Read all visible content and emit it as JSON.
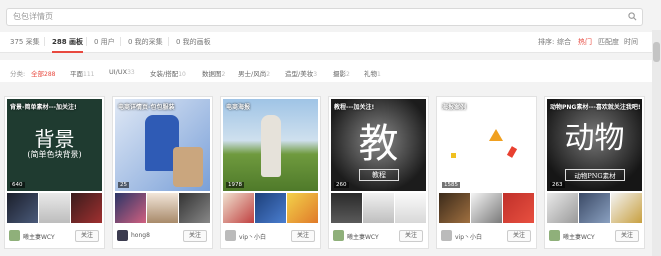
{
  "search": {
    "placeholder": "包包详情页"
  },
  "tabs": [
    {
      "label": "375 采集"
    },
    {
      "label": "288 画板"
    },
    {
      "label": "0 用户"
    },
    {
      "label": "0 我的采集"
    },
    {
      "label": "0 我的画板"
    }
  ],
  "sort": {
    "label": "排序:",
    "options": [
      "综合",
      "热门",
      "匹配度",
      "时间"
    ],
    "active": "热门"
  },
  "categories": {
    "label": "分类:",
    "items": [
      {
        "name": "全部",
        "count": "288"
      },
      {
        "name": "平面",
        "count": "111"
      },
      {
        "name": "UI/UX",
        "count": "33"
      },
      {
        "name": "女装/搭配",
        "count": "10"
      },
      {
        "name": "数据图",
        "count": "2"
      },
      {
        "name": "男士/风尚",
        "count": "2"
      },
      {
        "name": "造型/美妆",
        "count": "3"
      },
      {
        "name": "摄影",
        "count": "2"
      },
      {
        "name": "礼物",
        "count": "1"
      }
    ]
  },
  "cards": [
    {
      "title": "背景-简单素材---加关注!",
      "big": "背景",
      "sub": "(简单色块背景)",
      "count": "640",
      "user": "曦主妻WCY",
      "follow": "关注"
    },
    {
      "title": "电商详情页-包包服装",
      "count": "25",
      "user": "hong8",
      "follow": "关注"
    },
    {
      "title": "电商海报",
      "count": "1978",
      "user": "vip丶小白",
      "follow": "关注"
    },
    {
      "title": "教程---加关注!",
      "big": "教",
      "badge": "教程",
      "count": "260",
      "user": "曦主妻WCY",
      "follow": "关注"
    },
    {
      "title": "海报案例",
      "count": "1585",
      "user": "vip丶小白",
      "follow": "关注"
    },
    {
      "title": "动物PNG素材---喜欢就关注我吧!",
      "big": "动物",
      "badge": "动物PNG素材",
      "count": "263",
      "user": "曦主妻WCY",
      "follow": "关注"
    }
  ],
  "colors": {
    "accent": "#e8493f"
  }
}
